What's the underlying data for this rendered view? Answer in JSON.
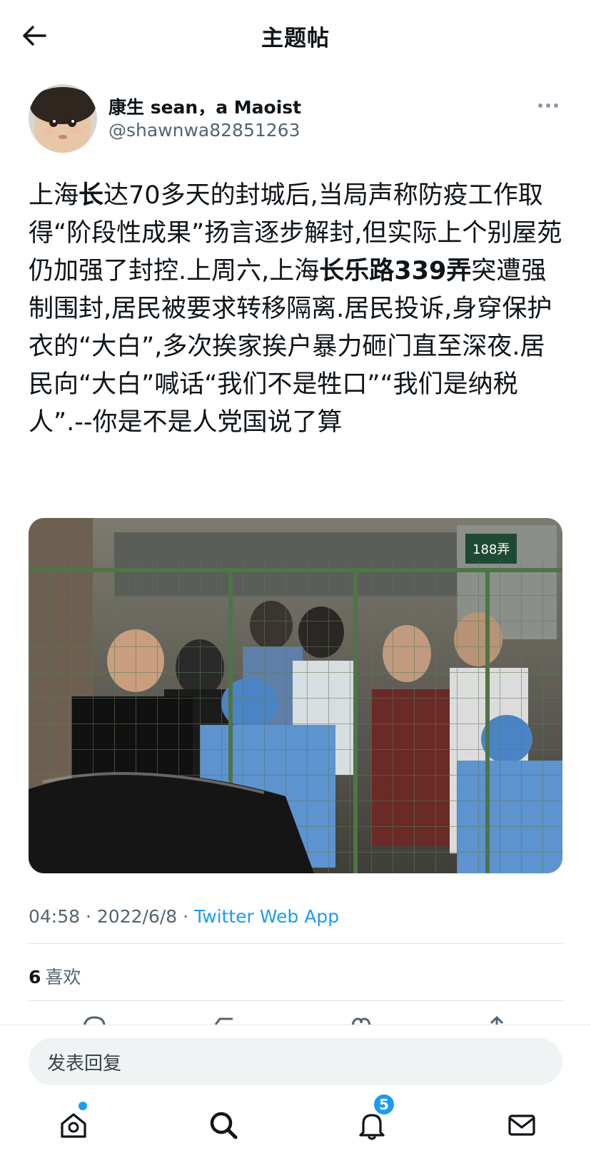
{
  "header": {
    "title": "主题帖"
  },
  "author": {
    "display_name": "康生 sean，a Maoist",
    "handle": "@shawnwa82851263"
  },
  "tweet": {
    "segments": [
      {
        "text": "上海",
        "bold": false
      },
      {
        "text": "长",
        "bold": true
      },
      {
        "text": "达70多天的封城后,当局声称防疫工作取得“阶段性成果”扬言逐步解封,但实际上个别屋苑仍加强了封控.上周六,上海",
        "bold": false
      },
      {
        "text": "长乐路339弄",
        "bold": true
      },
      {
        "text": "突遭强制围封,居民被要求转移隔离.居民投诉,身穿保护衣的“大白”,多次挨家挨户暴力砸门直至深夜.居民向“大白”喊话“我们不是牲口”“我们是纳税人”.--你是不是人党国说了算",
        "bold": false
      }
    ],
    "media_sign_text": "188弄"
  },
  "meta": {
    "time": "04:58",
    "sep1": " · ",
    "date": "2022/6/8",
    "sep2": " · ",
    "source": "Twitter Web App"
  },
  "stats": {
    "likes_count": "6",
    "likes_label": "喜欢"
  },
  "reply": {
    "placeholder": "发表回复"
  },
  "nav": {
    "notifications_badge": "5"
  },
  "colors": {
    "accent": "#1d9bf0",
    "secondary_text": "#536471"
  }
}
